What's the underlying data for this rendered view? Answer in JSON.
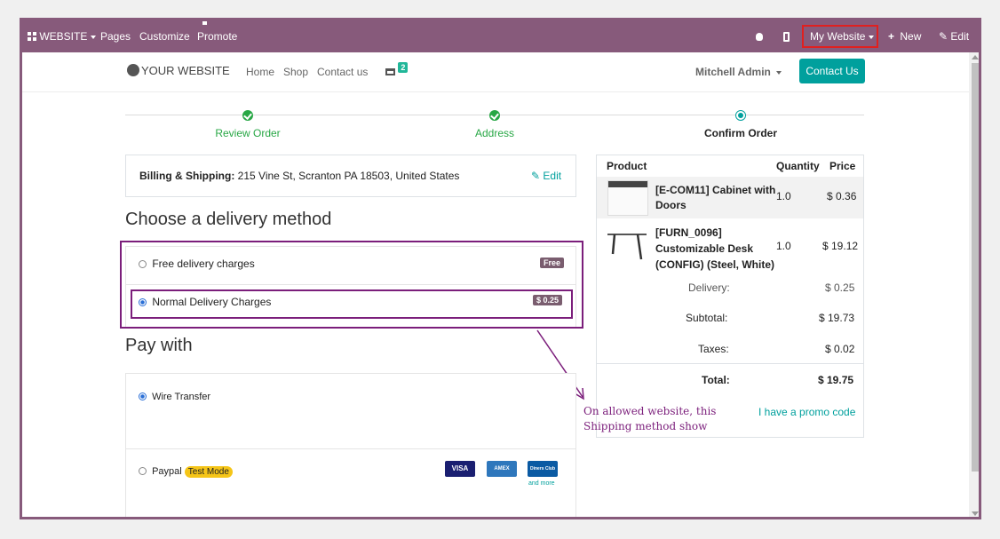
{
  "topbar": {
    "website_menu": "WEBSITE",
    "pages": "Pages",
    "customize": "Customize",
    "promote": "Promote",
    "my_website": "My Website",
    "new": "New",
    "edit": "Edit"
  },
  "nav": {
    "brand": "YOUR WEBSITE",
    "home": "Home",
    "shop": "Shop",
    "contact": "Contact us",
    "cart_count": "2",
    "user": "Mitchell Admin",
    "contact_btn": "Contact Us"
  },
  "steps": [
    {
      "label": "Review Order",
      "state": "done"
    },
    {
      "label": "Address",
      "state": "done"
    },
    {
      "label": "Confirm Order",
      "state": "active"
    }
  ],
  "billing": {
    "label": "Billing & Shipping:",
    "address": "215 Vine St, Scranton PA 18503, United States",
    "edit": "Edit"
  },
  "delivery": {
    "title": "Choose a delivery method",
    "options": [
      {
        "label": "Free delivery charges",
        "badge": "Free",
        "selected": false
      },
      {
        "label": "Normal Delivery Charges",
        "badge": "$ 0.25",
        "selected": true
      }
    ]
  },
  "payment": {
    "title": "Pay with",
    "options": [
      {
        "label": "Wire Transfer",
        "selected": true
      },
      {
        "label": "Paypal",
        "badge": "Test Mode",
        "selected": false
      }
    ],
    "cards": [
      "VISA",
      "AMEX",
      "Diners Club"
    ],
    "more": "and more"
  },
  "summary": {
    "headers": {
      "product": "Product",
      "quantity": "Quantity",
      "price": "Price"
    },
    "items": [
      {
        "name": "[E-COM11] Cabinet with Doors",
        "line1": "[E-COM11] Cabinet with",
        "line2": "Doors",
        "qty": "1.0",
        "price": "$ 0.36"
      },
      {
        "name": "[FURN_0096] Customizable Desk (CONFIG) (Steel, White)",
        "line1": "[FURN_0096]",
        "line2": "Customizable Desk",
        "line3": "(CONFIG) (Steel, White)",
        "qty": "1.0",
        "price": "$ 19.12"
      }
    ],
    "delivery_label": "Delivery:",
    "delivery": "$ 0.25",
    "subtotal_label": "Subtotal:",
    "subtotal": "$ 19.73",
    "taxes_label": "Taxes:",
    "taxes": "$ 0.02",
    "total_label": "Total:",
    "total": "$ 19.75",
    "promo": "I have a promo code"
  },
  "annotation": {
    "line1": "On allowed website, this",
    "line2": "Shipping method show"
  },
  "colors": {
    "odoo_purple": "#875a7b",
    "teal": "#00a09d",
    "success": "#28a745",
    "annotation": "#7b1e7b"
  }
}
